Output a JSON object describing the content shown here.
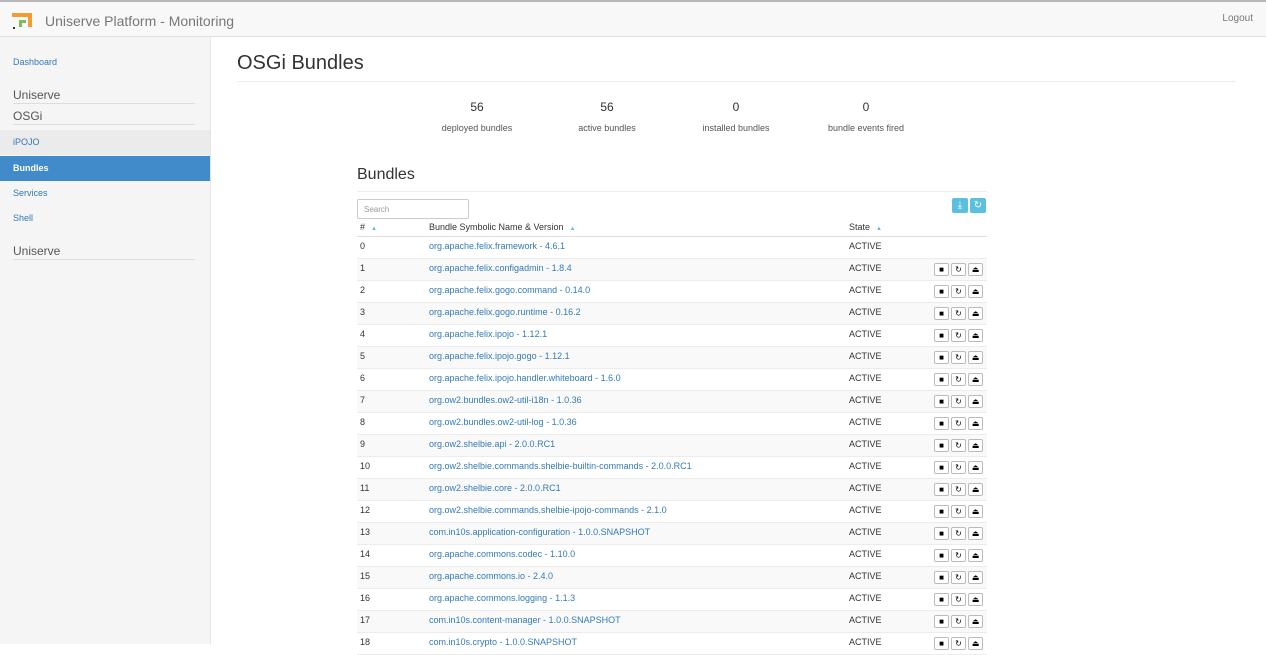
{
  "app": {
    "title": "Uniserve Platform - Monitoring",
    "logout": "Logout"
  },
  "sidebar": {
    "dashboard": "Dashboard",
    "header1": "Uniserve",
    "header2": "OSGi",
    "items": [
      {
        "label": "iPOJO"
      },
      {
        "label": "Bundles"
      },
      {
        "label": "Services"
      },
      {
        "label": "Shell"
      }
    ],
    "header3": "Uniserve"
  },
  "page": {
    "title": "OSGi Bundles"
  },
  "stats": [
    {
      "value": "56",
      "label": "deployed bundles"
    },
    {
      "value": "56",
      "label": "active bundles"
    },
    {
      "value": "0",
      "label": "installed bundles"
    },
    {
      "value": "0",
      "label": "bundle events fired"
    }
  ],
  "bundles_section": {
    "title": "Bundles",
    "search_placeholder": "Search",
    "install_icon": "⤓",
    "refresh_icon": "↻",
    "columns": {
      "id": "#",
      "name": "Bundle Symbolic Name & Version",
      "state": "State"
    },
    "sort_icon": "▲",
    "action_icons": {
      "stop": "■",
      "refresh": "↻",
      "uninstall": "⏏"
    },
    "rows": [
      {
        "id": "0",
        "name": "org.apache.felix.framework - 4.6.1",
        "state": "ACTIVE",
        "actions": false
      },
      {
        "id": "1",
        "name": "org.apache.felix.configadmin - 1.8.4",
        "state": "ACTIVE",
        "actions": true
      },
      {
        "id": "2",
        "name": "org.apache.felix.gogo.command - 0.14.0",
        "state": "ACTIVE",
        "actions": true
      },
      {
        "id": "3",
        "name": "org.apache.felix.gogo.runtime - 0.16.2",
        "state": "ACTIVE",
        "actions": true
      },
      {
        "id": "4",
        "name": "org.apache.felix.ipojo - 1.12.1",
        "state": "ACTIVE",
        "actions": true
      },
      {
        "id": "5",
        "name": "org.apache.felix.ipojo.gogo - 1.12.1",
        "state": "ACTIVE",
        "actions": true
      },
      {
        "id": "6",
        "name": "org.apache.felix.ipojo.handler.whiteboard - 1.6.0",
        "state": "ACTIVE",
        "actions": true
      },
      {
        "id": "7",
        "name": "org.ow2.bundles.ow2-util-i18n - 1.0.36",
        "state": "ACTIVE",
        "actions": true
      },
      {
        "id": "8",
        "name": "org.ow2.bundles.ow2-util-log - 1.0.36",
        "state": "ACTIVE",
        "actions": true
      },
      {
        "id": "9",
        "name": "org.ow2.shelbie.api - 2.0.0.RC1",
        "state": "ACTIVE",
        "actions": true
      },
      {
        "id": "10",
        "name": "org.ow2.shelbie.commands.shelbie-builtin-commands - 2.0.0.RC1",
        "state": "ACTIVE",
        "actions": true
      },
      {
        "id": "11",
        "name": "org.ow2.shelbie.core - 2.0.0.RC1",
        "state": "ACTIVE",
        "actions": true
      },
      {
        "id": "12",
        "name": "org.ow2.shelbie.commands.shelbie-ipojo-commands - 2.1.0",
        "state": "ACTIVE",
        "actions": true
      },
      {
        "id": "13",
        "name": "com.in10s.application-configuration - 1.0.0.SNAPSHOT",
        "state": "ACTIVE",
        "actions": true
      },
      {
        "id": "14",
        "name": "org.apache.commons.codec - 1.10.0",
        "state": "ACTIVE",
        "actions": true
      },
      {
        "id": "15",
        "name": "org.apache.commons.io - 2.4.0",
        "state": "ACTIVE",
        "actions": true
      },
      {
        "id": "16",
        "name": "org.apache.commons.logging - 1.1.3",
        "state": "ACTIVE",
        "actions": true
      },
      {
        "id": "17",
        "name": "com.in10s.content-manager - 1.0.0.SNAPSHOT",
        "state": "ACTIVE",
        "actions": true
      },
      {
        "id": "18",
        "name": "com.in10s.crypto - 1.0.0.SNAPSHOT",
        "state": "ACTIVE",
        "actions": true
      }
    ]
  }
}
